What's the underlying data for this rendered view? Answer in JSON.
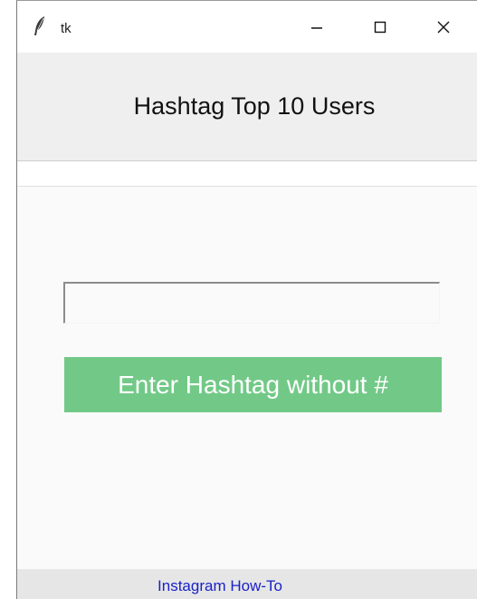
{
  "window": {
    "title": "tk",
    "icon": "feather-icon",
    "controls": {
      "minimize_icon": "minimize-icon",
      "maximize_icon": "maximize-icon",
      "close_icon": "close-icon"
    }
  },
  "header": {
    "title": "Hashtag Top 10 Users"
  },
  "form": {
    "hashtag_value": "",
    "submit_label": "Enter Hashtag without #"
  },
  "footer": {
    "link_label": "Instagram How-To"
  },
  "colors": {
    "button_bg": "#72c987",
    "button_text": "#ffffff",
    "header_bg": "#efefef",
    "footer_bg": "#e6e6e6",
    "link": "#1a22c8"
  }
}
